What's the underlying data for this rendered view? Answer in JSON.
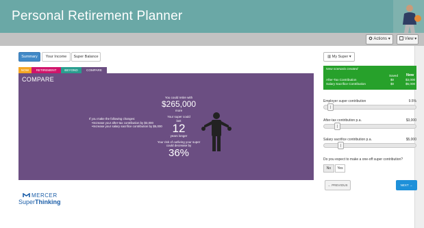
{
  "app": {
    "title": "Personal Retirement Planner"
  },
  "toolbar": {
    "actions_label": "Actions",
    "view_label": "View"
  },
  "primary_tabs": [
    "Summary",
    "Your Income",
    "Super Balance"
  ],
  "secondary_tabs": [
    "NOW",
    "RETIREMENT",
    "BEYOND",
    "COMPARE"
  ],
  "panel": {
    "title": "COMPARE",
    "changes_intro": "If you make the following changes:",
    "changes": [
      "Increase your after-tax contribution by $3,000",
      "Increase your salary sacrifice contribution by $5,000"
    ],
    "retire_prefix": "You could retire with",
    "retire_amount": "$265,000",
    "retire_suffix": "more",
    "last_prefix": "Your super could last",
    "last_years": "12",
    "last_suffix": "years longer",
    "risk_text": "Your risk of outliving your super could decrease by",
    "risk_pct": "36%"
  },
  "right": {
    "mysuper_label": "My Super",
    "scenario": {
      "title": "New scenario created",
      "col_saved": "Saved",
      "col_new": "New",
      "rows": [
        {
          "label": "After-Tax Contribution",
          "saved": "$0",
          "new": "$3,000"
        },
        {
          "label": "Salary Sacrifice Contribution",
          "saved": "$0",
          "new": "$5,000"
        }
      ]
    },
    "employer": {
      "label": "Employer super contribution",
      "value": "9.5%",
      "level": 0.04
    },
    "after_tax": {
      "label": "After-tax contribution p.a.",
      "value": "$3,000",
      "level": 0.12
    },
    "sacrifice": {
      "label": "Salary sacrifice contribution p.a.",
      "value": "$5,000",
      "level": 0.16
    },
    "oneoff_question": "Do you expect to make a one-off super contribution?",
    "no_label": "No",
    "yes_label": "Yes",
    "prev_label": "PREVIOUS",
    "next_label": "NEXT"
  },
  "logo": {
    "name": "MERCER",
    "tag_a": "Super",
    "tag_b": "Thinking"
  },
  "colors": {
    "header": "#6aa8a6",
    "panel": "#6b4e82",
    "scenario": "#27a12b",
    "accent": "#1e90d9"
  }
}
